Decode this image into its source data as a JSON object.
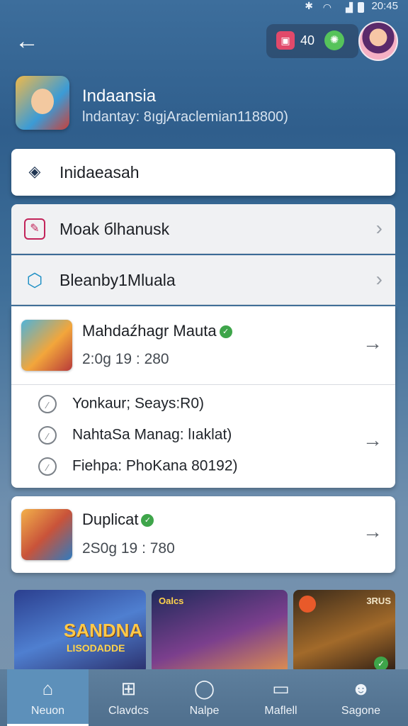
{
  "status": {
    "time": "20:45"
  },
  "header": {
    "back_label": "←",
    "gift_count": "40"
  },
  "app": {
    "title": "Indaansia",
    "subtitle": "lndantay: 8ıgjAraclemian118800)"
  },
  "search_card": {
    "label": "Inidaeasah"
  },
  "menu": [
    {
      "label": "Moak бlhanusk",
      "icon": "edit-box-icon"
    },
    {
      "label": "Bleanby1Mluala",
      "icon": "hexagon-icon"
    }
  ],
  "game1": {
    "title": "Mahdaźhagr Mauta",
    "time": "2:0g 19 : 280",
    "items": [
      "Yonkaur; Seays:R0)",
      "NahtaSa Manag: lıaklat)",
      "Fiehpa: PhoKana 80192)"
    ]
  },
  "game2": {
    "title": "Duplicat",
    "time": "2S0g 19 : 780"
  },
  "banners": [
    {
      "title": "SANDNA",
      "subtitle": "LISODADDE"
    },
    {
      "title": "Oalcs"
    },
    {
      "title": "3RUS"
    }
  ],
  "nav": [
    {
      "label": "Neuon",
      "icon": "home-icon"
    },
    {
      "label": "Clavdcs",
      "icon": "games-icon"
    },
    {
      "label": "Nalpe",
      "icon": "user-icon"
    },
    {
      "label": "Maflell",
      "icon": "message-icon"
    },
    {
      "label": "Sagone",
      "icon": "profile-icon"
    }
  ],
  "colors": {
    "accent": "#3ea54a",
    "nav_active": "#5d90ba",
    "gift": "#e1496a"
  }
}
